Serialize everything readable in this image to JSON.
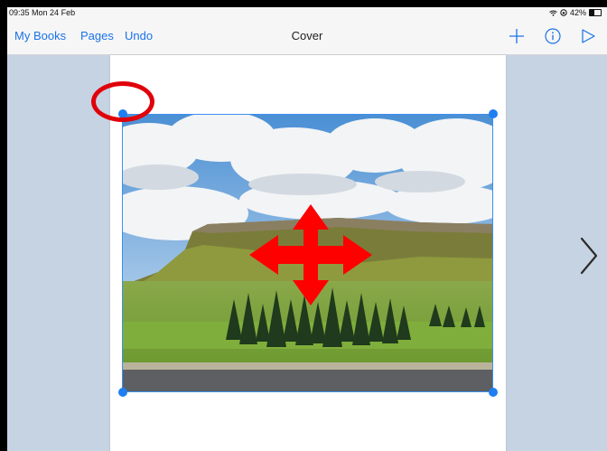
{
  "status_bar": {
    "time": "09:35",
    "date": "Mon 24 Feb",
    "battery": "42%",
    "battery_level": 0.42,
    "wifi_icon": "wifi-icon",
    "orientation_lock_icon": "orientation-lock-icon"
  },
  "nav": {
    "my_books": "My Books",
    "pages": "Pages",
    "undo": "Undo",
    "title": "Cover",
    "icons": [
      "plus-icon",
      "info-icon",
      "play-icon"
    ]
  },
  "canvas": {
    "background": "#c6d3e2",
    "selection_color": "#1f7ff0",
    "annotation_color": "#e0000a"
  },
  "photo": {
    "subject": "landscape photo of a flat-topped hill with clouds and trees",
    "selected": true
  },
  "annotations": [
    "red-circle-annotation",
    "red-move-arrow-annotation"
  ],
  "next_page_icon": "chevron-right-icon"
}
